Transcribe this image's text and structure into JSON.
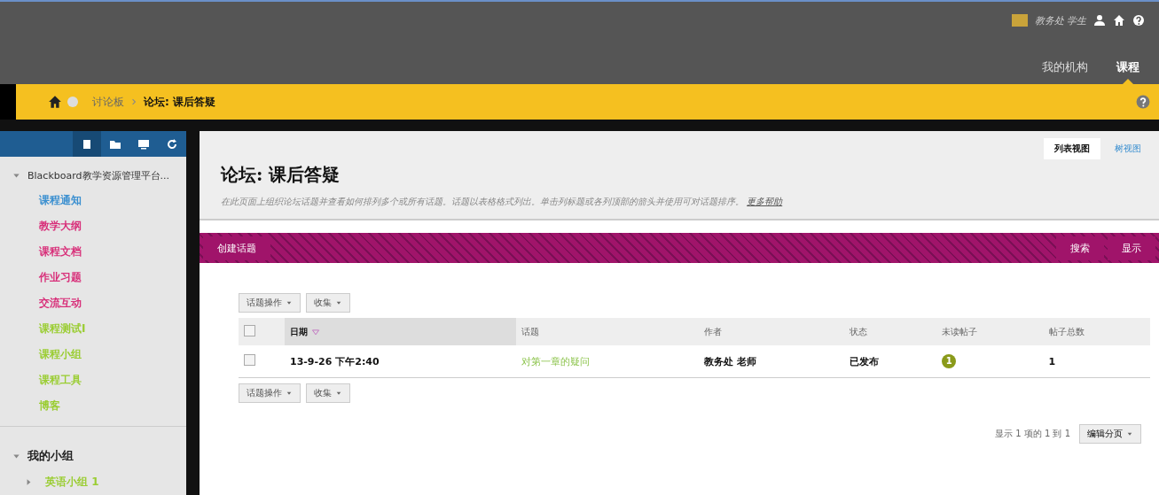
{
  "top_bar": {
    "user": "教务处 学生",
    "tabs": [
      {
        "label": "我的机构",
        "selected": false
      },
      {
        "label": "课程",
        "selected": true
      }
    ]
  },
  "breadcrumb": [
    "讨论板",
    "论坛: 课后答疑"
  ],
  "sidebar": {
    "tools": [
      {
        "kind": "list",
        "selected": true
      },
      {
        "kind": "folder",
        "selected": false
      },
      {
        "kind": "screen",
        "selected": false
      },
      {
        "kind": "refresh",
        "selected": false
      }
    ],
    "course_title": "Blackboard教学资源管理平台...",
    "items": [
      {
        "label": "课程通知",
        "color": "#3a8fd0"
      },
      {
        "label": "教学大纲",
        "color": "#d8307a"
      },
      {
        "label": "课程文档",
        "color": "#d8307a"
      },
      {
        "label": "作业习题",
        "color": "#d8307a"
      },
      {
        "label": "交流互动",
        "color": "#d8307a"
      },
      {
        "label": "课程测试I",
        "color": "#9acd32"
      },
      {
        "label": "课程小组",
        "color": "#9acd32"
      },
      {
        "label": "课程工具",
        "color": "#9acd32"
      },
      {
        "label": "博客",
        "color": "#9acd32"
      }
    ],
    "groups_title": "我的小组",
    "groups": [
      {
        "label": "英语小组 1",
        "color": "#9acd32"
      }
    ]
  },
  "page": {
    "view_tabs": [
      {
        "label": "列表视图",
        "selected": true
      },
      {
        "label": "树视图",
        "selected": false
      }
    ],
    "title": "论坛: 课后答疑",
    "description": "在此页面上组织论坛话题并查看如何排列多个或所有话题。话题以表格格式列出。单击列标题或各列顶部的箭头并使用可对话题排序。",
    "help_link": "更多帮助",
    "action_bar": {
      "left": [
        "创建话题"
      ],
      "right": [
        "搜索",
        "显示"
      ]
    },
    "list_actions": [
      "话题操作",
      "收集"
    ],
    "table": {
      "select_all_checked": false,
      "columns": [
        {
          "label": "日期",
          "sorted": true
        },
        {
          "label": "话题",
          "sorted": false
        },
        {
          "label": "作者",
          "sorted": false
        },
        {
          "label": "状态",
          "sorted": false
        },
        {
          "label": "未读帖子",
          "sorted": false
        },
        {
          "label": "帖子总数",
          "sorted": false
        }
      ],
      "rows": [
        {
          "checked": false,
          "cells": [
            "13-9-26 下午2:40",
            "对第一章的疑问",
            "教务处 老师",
            "已发布",
            "1",
            "1"
          ]
        }
      ]
    },
    "list_actions_bottom": [
      "话题操作",
      "收集"
    ],
    "pager": {
      "summary": "显示 1 项的 1 到 1",
      "edit": "编辑分页"
    }
  }
}
